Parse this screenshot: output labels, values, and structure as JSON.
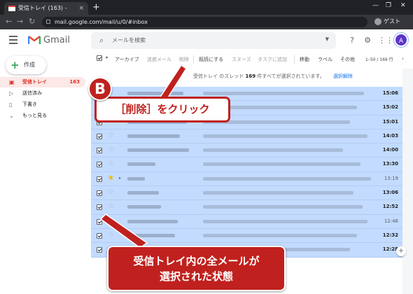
{
  "browser": {
    "tab_title": "受信トレイ (163) -",
    "tab_close": "×",
    "new_tab": "+",
    "url": "mail.google.com/mail/u/0/#inbox",
    "profile_label": "ゲスト",
    "window_controls": [
      "—",
      "❐",
      "✕"
    ]
  },
  "header": {
    "logo_text": "Gmail",
    "search_placeholder": "メールを検索",
    "avatar_letter": "A"
  },
  "sidebar": {
    "compose_label": "作成",
    "items": [
      {
        "label": "受信トレイ",
        "count": "163",
        "icon": "inbox-icon",
        "active": true
      },
      {
        "label": "送信済み",
        "count": "",
        "icon": "send-icon"
      },
      {
        "label": "下書き",
        "count": "",
        "icon": "draft-icon"
      },
      {
        "label": "もっと見る",
        "count": "",
        "icon": "chevron-down-icon"
      }
    ]
  },
  "toolbar": {
    "archive": "アーカイブ",
    "spam": "迷惑メール",
    "delete": "削除",
    "mark_read": "既読にする",
    "snooze": "スヌーズ",
    "add_task": "タスクに追加",
    "move": "移動",
    "label": "ラベル",
    "more": "その他",
    "pagination": "1–50 / 169 行"
  },
  "notice": {
    "prefix": "受信トレイ のスレッド",
    "count": "169",
    "suffix": "件すべてが選択されています。",
    "clear_link": "選択解除"
  },
  "mail_times": [
    "15:06",
    "15:02",
    "15:01",
    "14:03",
    "14:00",
    "13:30",
    "13:19",
    "13:06",
    "12:52",
    "12:46",
    "12:32",
    "12:28"
  ],
  "callouts": {
    "step_badge": "B",
    "step_text": "［削除］をクリック",
    "note_line1": "受信トレイ内の全メールが",
    "note_line2": "選択された状態"
  },
  "colors": {
    "selected_row": "#c2dbff",
    "callout_red": "#c0211e",
    "gmail_red": "#d93025"
  }
}
